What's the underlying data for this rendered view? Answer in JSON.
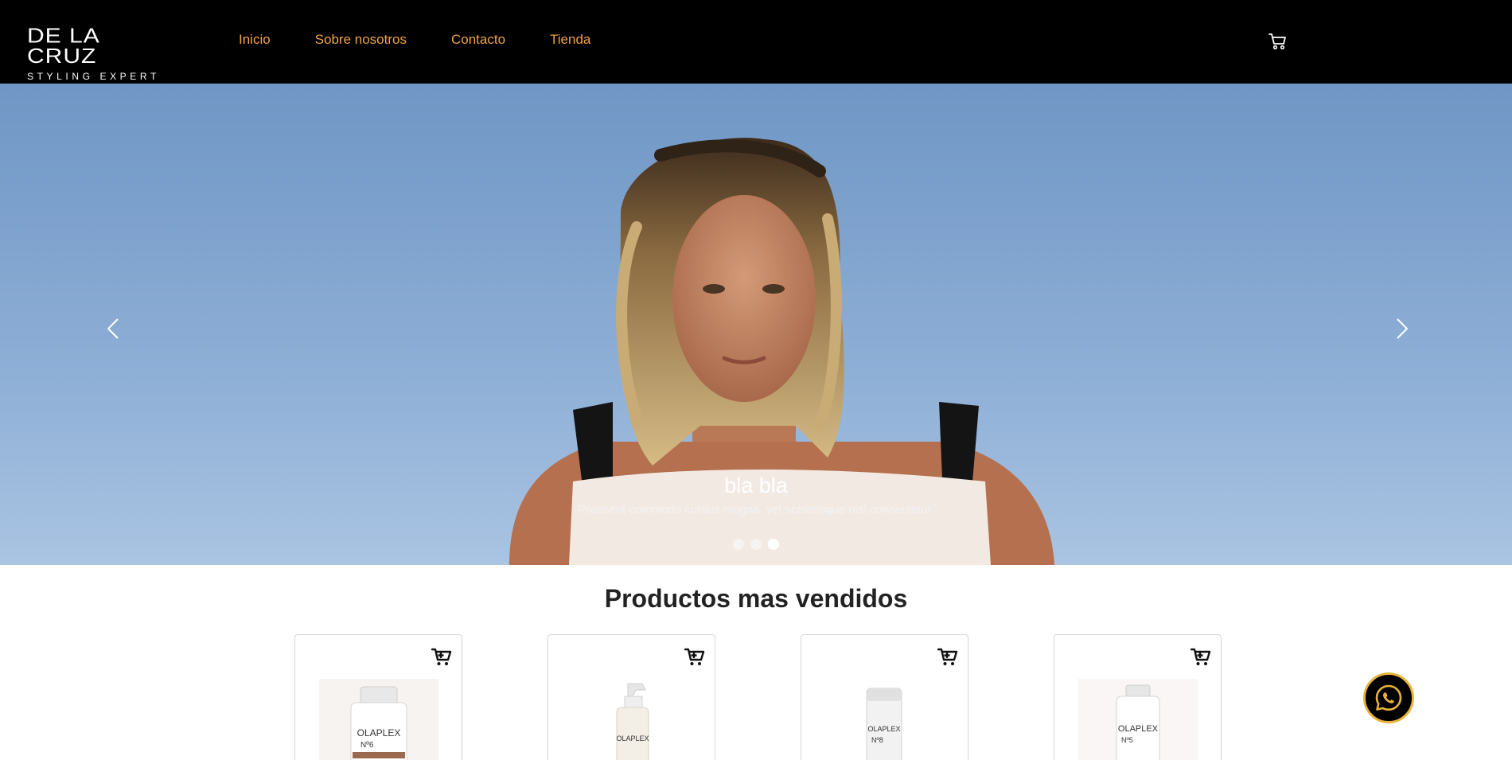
{
  "brand": {
    "name": "DE LA CRUZ",
    "tagline": "STYLING EXPERT"
  },
  "nav": {
    "links": [
      {
        "label": "Inicio"
      },
      {
        "label": "Sobre nosotros"
      },
      {
        "label": "Contacto"
      },
      {
        "label": "Tienda"
      }
    ],
    "cart_icon": "cart-icon",
    "link_color": "#f0a34a",
    "background": "#000000"
  },
  "hero": {
    "slides_count": 3,
    "active_slide": 3,
    "caption_title": "bla bla",
    "caption_text": "Praesent commodo cursus magna, vel scelerisque nisl consectetur.",
    "prev_icon": "chevron-left-icon",
    "next_icon": "chevron-right-icon"
  },
  "products_section": {
    "title": "Productos mas vendidos",
    "products": [
      {
        "name": "OLAPLEX No6",
        "brand_text": "OLAPLEX",
        "number_text": "Nº6",
        "add_icon": "add-to-cart-icon"
      },
      {
        "name": "OLAPLEX spray",
        "brand_text": "OLAPLEX",
        "number_text": "",
        "add_icon": "add-to-cart-icon"
      },
      {
        "name": "OLAPLEX No8",
        "brand_text": "OLAPLEX",
        "number_text": "Nº8",
        "add_icon": "add-to-cart-icon"
      },
      {
        "name": "OLAPLEX No5",
        "brand_text": "OLAPLEX",
        "number_text": "Nº5",
        "add_icon": "add-to-cart-icon"
      }
    ]
  },
  "whatsapp": {
    "icon": "whatsapp-icon",
    "border_color": "#e7b33a"
  }
}
